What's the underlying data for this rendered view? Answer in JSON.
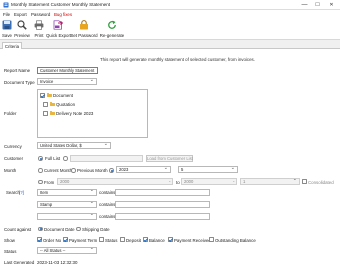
{
  "window": {
    "title": "Monthly Statement Customer Monthly Statement",
    "minimize": "—",
    "maximize": "☐",
    "close": "✕"
  },
  "menu": [
    "File",
    "Export",
    "Password",
    "Bug fixes"
  ],
  "toolbar": {
    "save": "Save",
    "preview": "Preview",
    "print": "Print",
    "quick_export": "Quick Export",
    "set_password": "Set Password",
    "regenerate": "Re-generate"
  },
  "tabs": [
    "Criteria"
  ],
  "description": "This report will generate monthly statement of selected customer, from invoices.",
  "form": {
    "report_name_label": "Report Name",
    "report_name": "Customer Monthly Statement",
    "document_type_label": "Document Type",
    "document_type": "Invoice",
    "folder_label": "Folder",
    "folders": [
      {
        "name": "Document",
        "checked": true,
        "indent": 0
      },
      {
        "name": "Quotation",
        "checked": false,
        "indent": 1
      },
      {
        "name": "Delivery Note 2023",
        "checked": false,
        "indent": 1
      }
    ],
    "currency_label": "Currency",
    "currency": "United States Dollar, $",
    "customer_label": "Customer",
    "customer_full_list": "Full List",
    "customer_from_list_button": "Load from Customer List",
    "month_label": "Month",
    "current_month": "Current Month",
    "previous_month": "Previous Month",
    "year": "2023",
    "month": "5",
    "from_label": "From",
    "from_value": "2000",
    "to_label": "to",
    "to_year": "2000",
    "to_month": "1",
    "consolidated": "Consolidated",
    "search_label": "Search",
    "search_link": "[?]",
    "search_rows": [
      {
        "field": "Item",
        "op": "contains",
        "value": ""
      },
      {
        "field": "Stamp",
        "op": "contains",
        "value": ""
      },
      {
        "field": "",
        "op": "contains",
        "value": ""
      }
    ],
    "count_against_label": "Count against",
    "count_document_date": "Document Date",
    "count_shipping_date": "Shipping Date",
    "show_label": "Show",
    "show_options": [
      {
        "name": "Order No",
        "checked": true
      },
      {
        "name": "Payment Term",
        "checked": true
      },
      {
        "name": "Status",
        "checked": false
      },
      {
        "name": "Deposit",
        "checked": false
      },
      {
        "name": "Balance",
        "checked": true
      },
      {
        "name": "Payment Received",
        "checked": true
      },
      {
        "name": "Outstanding Balance",
        "checked": false
      }
    ],
    "status_label": "Status",
    "status": "-- All Status --",
    "last_generated_label": "Last Generated",
    "last_generated": "2023-11-03 12:32:30"
  },
  "colors": {
    "accent": "#1565c0",
    "link": "#1a56c8",
    "menu_highlight": "#cc0000"
  }
}
